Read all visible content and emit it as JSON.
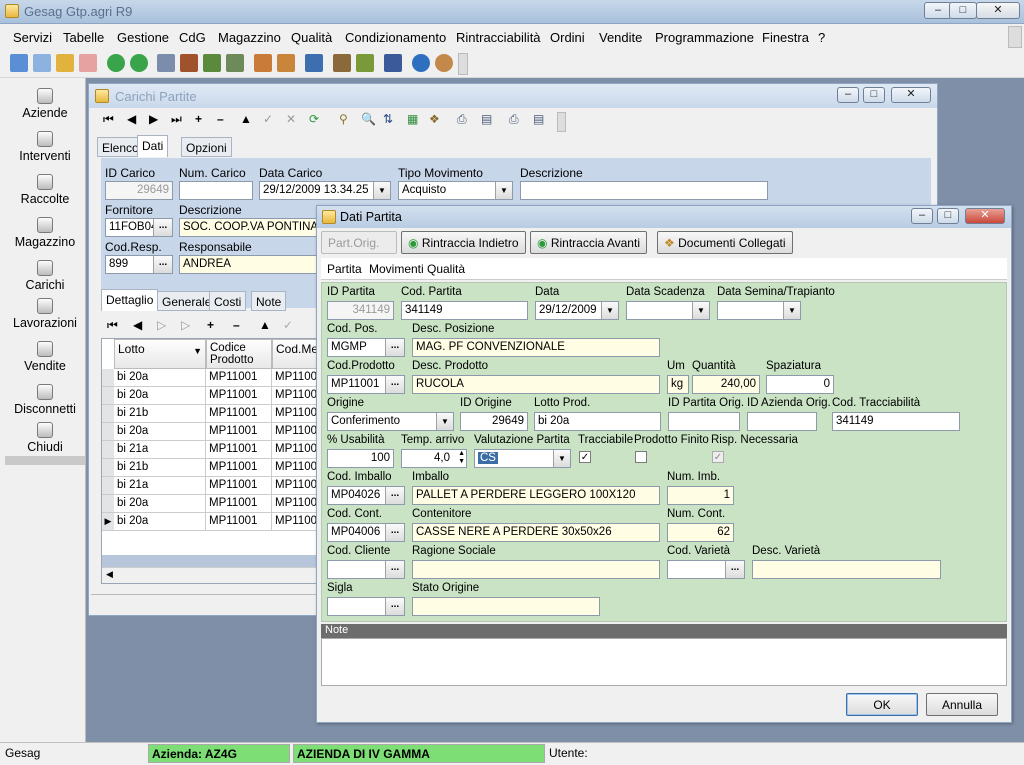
{
  "app": {
    "title": "Gesag Gtp.agri R9"
  },
  "menu": [
    "Servizi",
    "Tabelle",
    "Gestione",
    "CdG",
    "Magazzino",
    "Qualità",
    "Condizionamento",
    "Rintracciabilità",
    "Ordini",
    "Vendite",
    "Programmazione",
    "Finestra",
    "?"
  ],
  "nav": [
    {
      "label": "Aziende",
      "icon": "flower-icon"
    },
    {
      "label": "Interventi",
      "icon": "tractor-icon"
    },
    {
      "label": "Raccolte",
      "icon": "harvest-icon"
    },
    {
      "label": "Magazzino",
      "icon": "warehouse-icon"
    },
    {
      "label": "Carichi",
      "icon": "truck-icon"
    },
    {
      "label": "Lavorazioni",
      "icon": "gears-icon"
    },
    {
      "label": "Vendite",
      "icon": "invoice-icon"
    },
    {
      "label": "Disconnetti",
      "icon": "key-icon"
    },
    {
      "label": "Chiudi",
      "icon": "exit-icon"
    }
  ],
  "status": {
    "app": "Gesag",
    "azienda": "Azienda: AZ4G",
    "azienda_name": "AZIENDA DI IV GAMMA",
    "utente": "Utente:"
  },
  "carichi": {
    "title": "Carichi Partite",
    "tabs": [
      "Elenco",
      "Dati",
      "Opzioni"
    ],
    "fields": {
      "id_label": "ID Carico",
      "id": "29649",
      "num_label": "Num. Carico",
      "num": "",
      "data_label": "Data Carico",
      "data": "29/12/2009 13.34.25",
      "tipo_label": "Tipo Movimento",
      "tipo": "Acquisto",
      "desc_label": "Descrizione",
      "desc": "",
      "forn_label": "Fornitore",
      "forn": "11FOB04",
      "forn_desc_label": "Descrizione",
      "forn_desc": "SOC. COOP.VA PONTINATU",
      "resp_code_label": "Cod.Resp.",
      "resp_code": "899",
      "resp_label": "Responsabile",
      "resp": "ANDREA"
    },
    "subtabs": [
      "Dettaglio",
      "Generale",
      "Costi",
      "Note"
    ],
    "grid": {
      "headers": [
        "Lotto",
        "Codice Prodotto",
        "Cod.Merc"
      ],
      "rows": [
        [
          "bi 20a",
          "MP11001",
          "MP1100"
        ],
        [
          "bi 20a",
          "MP11001",
          "MP1100"
        ],
        [
          "bi 21b",
          "MP11001",
          "MP1100"
        ],
        [
          "bi 20a",
          "MP11001",
          "MP1100"
        ],
        [
          "bi 21a",
          "MP11001",
          "MP1100"
        ],
        [
          "bi 21b",
          "MP11001",
          "MP1100"
        ],
        [
          "bi 21a",
          "MP11001",
          "MP1100"
        ],
        [
          "bi 20a",
          "MP11001",
          "MP1100"
        ],
        [
          "bi 20a",
          "MP11001",
          "MP1100"
        ]
      ]
    }
  },
  "dati": {
    "title": "Dati Partita",
    "btn_part_orig": "Part.Orig.",
    "btn_indietro": "Rintraccia Indietro",
    "btn_avanti": "Rintraccia Avanti",
    "btn_documenti": "Documenti Collegati",
    "tabs": [
      "Partita",
      "Movimenti",
      "Qualità"
    ],
    "labels": {
      "id_partita": "ID Partita",
      "cod_partita": "Cod. Partita",
      "data": "Data",
      "data_scadenza": "Data Scadenza",
      "data_semina": "Data Semina/Trapianto",
      "cod_pos": "Cod. Pos.",
      "desc_pos": "Desc. Posizione",
      "cod_prod": "Cod.Prodotto",
      "desc_prod": "Desc. Prodotto",
      "um": "Um",
      "quantita": "Quantità",
      "spaziatura": "Spaziatura",
      "origine": "Origine",
      "id_origine": "ID Origine",
      "lotto_prod": "Lotto Prod.",
      "id_partita_orig": "ID Partita Orig.",
      "id_azienda_orig": "ID Azienda Orig.",
      "cod_tracc": "Cod. Tracciabilità",
      "usabilita": "% Usabilità",
      "temp": "Temp. arrivo",
      "valutazione": "Valutazione Partita",
      "tracciabile": "Tracciabile",
      "prodotto_finito": "Prodotto Finito",
      "risp": "Risp. Necessaria",
      "cod_imballo": "Cod. Imballo",
      "imballo": "Imballo",
      "num_imb": "Num. Imb.",
      "cod_cont": "Cod. Cont.",
      "contenitore": "Contenitore",
      "num_cont": "Num. Cont.",
      "cod_cliente": "Cod. Cliente",
      "ragione": "Ragione Sociale",
      "cod_varieta": "Cod. Varietà",
      "desc_varieta": "Desc. Varietà",
      "sigla": "Sigla",
      "stato_origine": "Stato Origine",
      "note": "Note"
    },
    "values": {
      "id_partita": "341149",
      "cod_partita": "341149",
      "data": "29/12/2009",
      "data_scadenza": "",
      "data_semina": "",
      "cod_pos": "MGMP",
      "desc_pos": "MAG. PF CONVENZIONALE",
      "cod_prod": "MP11001",
      "desc_prod": "RUCOLA",
      "um": "kg",
      "quantita": "240,00",
      "spaziatura": "0",
      "origine": "Conferimento",
      "id_origine": "29649",
      "lotto_prod": "bi 20a",
      "id_partita_orig": "",
      "id_azienda_orig": "",
      "cod_tracc": "341149",
      "usabilita": "100",
      "temp": "4,0",
      "valutazione": "CS",
      "cod_imballo": "MP04026",
      "imballo": "PALLET A PERDERE LEGGERO 100X120",
      "num_imb": "1",
      "cod_cont": "MP04006",
      "contenitore": "CASSE NERE A PERDERE 30x50x26",
      "num_cont": "62",
      "cod_cliente": "",
      "ragione": "",
      "cod_varieta": "",
      "desc_varieta": "",
      "sigla": "",
      "stato_origine": ""
    },
    "ok": "OK",
    "annulla": "Annulla"
  }
}
